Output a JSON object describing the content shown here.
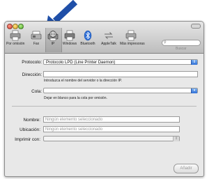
{
  "toolbar": {
    "items": [
      {
        "label": "Por omisión",
        "icon": "printer-default-icon"
      },
      {
        "label": "Fax",
        "icon": "fax-icon"
      },
      {
        "label": "IP",
        "icon": "ip-printer-globe-icon",
        "selected": true
      },
      {
        "label": "Windows",
        "icon": "windows-printer-icon"
      },
      {
        "label": "Bluetooth",
        "icon": "bluetooth-icon"
      },
      {
        "label": "AppleTalk",
        "icon": "appletalk-icon"
      },
      {
        "label": "Más impresoras",
        "icon": "more-printers-icon"
      }
    ],
    "search_label": "Buscar"
  },
  "form": {
    "protocol_label": "Protocolo:",
    "protocol_value": "Protocolo LPD (Line Printer Daemon)",
    "address_label": "Dirección:",
    "address_value": "",
    "address_hint": "Introduzca el nombre del servidor o la dirección IP.",
    "queue_label": "Cola:",
    "queue_value": "",
    "queue_hint": "Dejar en blanco para la cola por omisión.",
    "name_label": "Nombre:",
    "name_value": "Ningún elemento seleccionado",
    "location_label": "Ubicación:",
    "location_value": "Ningún elemento seleccionado",
    "print_with_label": "Imprimir con:",
    "print_with_value": ""
  },
  "buttons": {
    "add_label": "Añadir"
  },
  "colors": {
    "arrow": "#1f4fa8",
    "accent": "#2f6fd6"
  }
}
